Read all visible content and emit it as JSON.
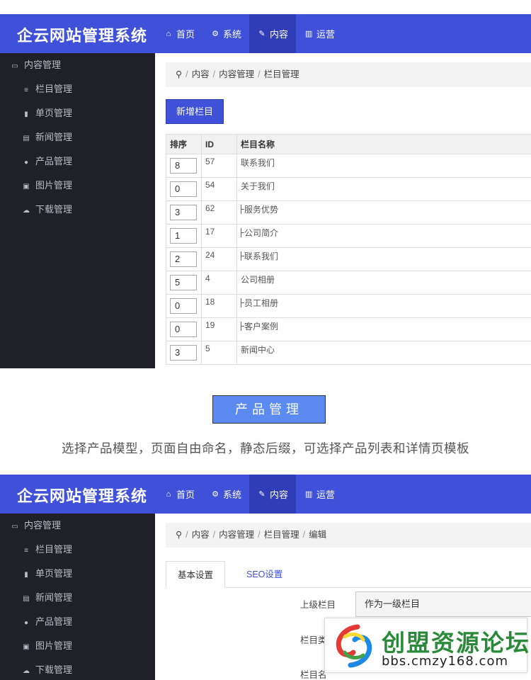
{
  "app": {
    "title": "企云网站管理系统"
  },
  "nav": [
    {
      "icon": "home-icon",
      "glyph": "⌂",
      "label": "首页",
      "active": false
    },
    {
      "icon": "gears-icon",
      "glyph": "⚙",
      "label": "系统",
      "active": false
    },
    {
      "icon": "edit-icon",
      "glyph": "✎",
      "label": "内容",
      "active": true
    },
    {
      "icon": "bar-chart-icon",
      "glyph": "▥",
      "label": "运营",
      "active": false
    }
  ],
  "sidebar": {
    "head": "内容管理",
    "items": [
      {
        "icon": "list-icon",
        "glyph": "≡",
        "label": "栏目管理"
      },
      {
        "icon": "file-icon",
        "glyph": "▮",
        "label": "单页管理"
      },
      {
        "icon": "newspaper-icon",
        "glyph": "▤",
        "label": "新闻管理"
      },
      {
        "icon": "product-icon",
        "glyph": "●",
        "label": "产品管理"
      },
      {
        "icon": "image-icon",
        "glyph": "▣",
        "label": "图片管理"
      },
      {
        "icon": "cloud-download-icon",
        "glyph": "☁",
        "label": "下载管理"
      }
    ]
  },
  "screen1": {
    "breadcrumb": [
      "内容",
      "内容管理",
      "栏目管理"
    ],
    "add_button": "新增栏目",
    "columns": [
      "排序",
      "ID",
      "栏目名称"
    ],
    "rows": [
      {
        "sort": "8",
        "id": "57",
        "name": "联系我们",
        "child": false
      },
      {
        "sort": "0",
        "id": "54",
        "name": "关于我们",
        "child": false
      },
      {
        "sort": "3",
        "id": "62",
        "name": "服务优势",
        "child": true
      },
      {
        "sort": "1",
        "id": "17",
        "name": "公司简介",
        "child": true
      },
      {
        "sort": "2",
        "id": "24",
        "name": "联系我们",
        "child": true
      },
      {
        "sort": "5",
        "id": "4",
        "name": "公司相册",
        "child": false
      },
      {
        "sort": "0",
        "id": "18",
        "name": "员工相册",
        "child": true
      },
      {
        "sort": "0",
        "id": "19",
        "name": "客户案例",
        "child": true
      },
      {
        "sort": "3",
        "id": "5",
        "name": "新闻中心",
        "child": false
      }
    ]
  },
  "section": {
    "heading": "产品管理",
    "description": "选择产品模型，页面自由命名，静态后缀，可选择产品列表和详情页模板"
  },
  "screen2": {
    "breadcrumb": [
      "内容",
      "内容管理",
      "栏目管理",
      "编辑"
    ],
    "tabs": [
      "基本设置",
      "SEO设置"
    ],
    "fields": [
      {
        "label": "上级栏目",
        "value": "作为一级栏目"
      },
      {
        "label": "栏目类",
        "value": ""
      },
      {
        "label": "栏目名",
        "value": ""
      }
    ]
  },
  "watermark": {
    "title": "创盟资源论坛",
    "url": "bbs.cmzy168.com"
  },
  "colors": {
    "brand": "#3f51d8",
    "sidebar": "#1f2028",
    "heading_box": "#5b8bf0",
    "watermark_green": "#2a8a3a"
  }
}
